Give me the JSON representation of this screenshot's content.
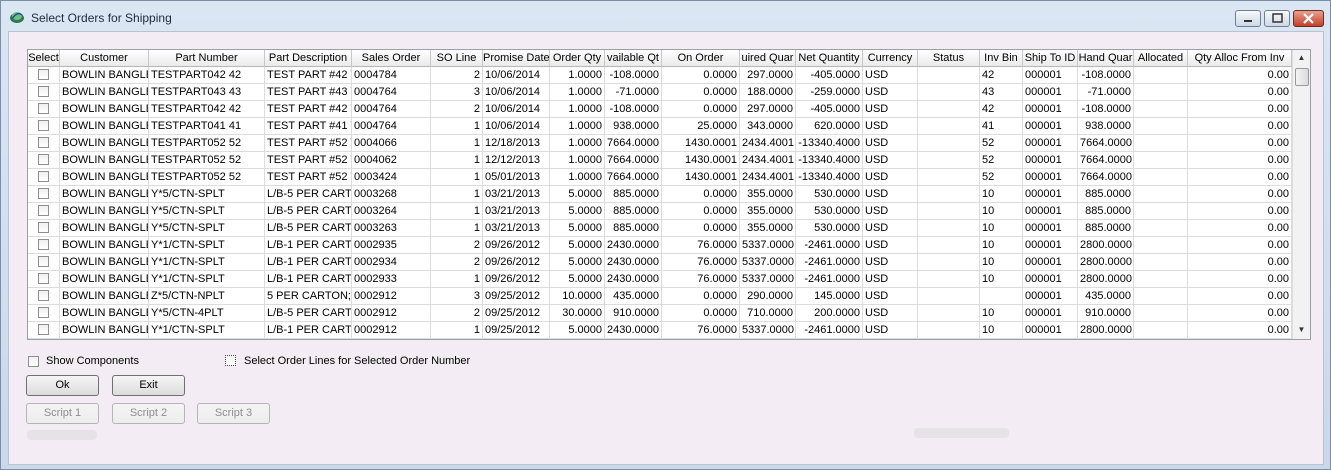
{
  "window": {
    "title": "Select Orders for Shipping"
  },
  "grid": {
    "columns": [
      "Select",
      "Customer",
      "Part Number",
      "Part Description",
      "Sales Order",
      "SO Line",
      "Promise Date",
      "Order Qty",
      "vailable Qt",
      "On Order",
      "uired Quar",
      "Net Quantity",
      "Currency",
      "Status",
      "Inv Bin",
      "Ship To ID",
      "Hand Quar",
      "Allocated",
      "Qty Alloc From Inv"
    ],
    "rows": [
      [
        "BOWLIN BANGLE",
        "TESTPART042      42",
        "TEST PART #42 V",
        "0004784",
        "2",
        "10/06/2014",
        "1.0000",
        "-108.0000",
        "0.0000",
        "297.0000",
        "-405.0000",
        "USD",
        "",
        "42",
        "000001",
        "-108.0000",
        "",
        "0.00"
      ],
      [
        "BOWLIN BANGLE",
        "TESTPART043      43",
        "TEST PART #43 V",
        "0004764",
        "3",
        "10/06/2014",
        "1.0000",
        "-71.0000",
        "0.0000",
        "188.0000",
        "-259.0000",
        "USD",
        "",
        "43",
        "000001",
        "-71.0000",
        "",
        "0.00"
      ],
      [
        "BOWLIN BANGLE",
        "TESTPART042      42",
        "TEST PART #42 V",
        "0004764",
        "2",
        "10/06/2014",
        "1.0000",
        "-108.0000",
        "0.0000",
        "297.0000",
        "-405.0000",
        "USD",
        "",
        "42",
        "000001",
        "-108.0000",
        "",
        "0.00"
      ],
      [
        "BOWLIN BANGLE",
        "TESTPART041      41",
        "TEST PART #41 V",
        "0004764",
        "1",
        "10/06/2014",
        "1.0000",
        "938.0000",
        "25.0000",
        "343.0000",
        "620.0000",
        "USD",
        "",
        "41",
        "000001",
        "938.0000",
        "",
        "0.00"
      ],
      [
        "BOWLIN BANGLE",
        "TESTPART052      52",
        "TEST PART #52 V",
        "0004066",
        "1",
        "12/18/2013",
        "1.0000",
        "7664.0000",
        "1430.0001",
        "2434.4001",
        "-13340.4000",
        "USD",
        "",
        "52",
        "000001",
        "7664.0000",
        "",
        "0.00"
      ],
      [
        "BOWLIN BANGLE",
        "TESTPART052      52",
        "TEST PART #52 V",
        "0004062",
        "1",
        "12/12/2013",
        "1.0000",
        "7664.0000",
        "1430.0001",
        "2434.4001",
        "-13340.4000",
        "USD",
        "",
        "52",
        "000001",
        "7664.0000",
        "",
        "0.00"
      ],
      [
        "BOWLIN BANGLE",
        "TESTPART052      52",
        "TEST PART #52 V",
        "0003424",
        "1",
        "05/01/2013",
        "1.0000",
        "7664.0000",
        "1430.0001",
        "2434.4001",
        "-13340.4000",
        "USD",
        "",
        "52",
        "000001",
        "7664.0000",
        "",
        "0.00"
      ],
      [
        "BOWLIN BANGLE",
        "Y*5/CTN-SPLT",
        "L/B-5 PER CARTC",
        "0003268",
        "1",
        "03/21/2013",
        "5.0000",
        "885.0000",
        "0.0000",
        "355.0000",
        "530.0000",
        "USD",
        "",
        "10",
        "000001",
        "885.0000",
        "",
        "0.00"
      ],
      [
        "BOWLIN BANGLE",
        "Y*5/CTN-SPLT",
        "L/B-5 PER CARTC",
        "0003264",
        "1",
        "03/21/2013",
        "5.0000",
        "885.0000",
        "0.0000",
        "355.0000",
        "530.0000",
        "USD",
        "",
        "10",
        "000001",
        "885.0000",
        "",
        "0.00"
      ],
      [
        "BOWLIN BANGLE",
        "Y*5/CTN-SPLT",
        "L/B-5 PER CARTC",
        "0003263",
        "1",
        "03/21/2013",
        "5.0000",
        "885.0000",
        "0.0000",
        "355.0000",
        "530.0000",
        "USD",
        "",
        "10",
        "000001",
        "885.0000",
        "",
        "0.00"
      ],
      [
        "BOWLIN BANGLE",
        "Y*1/CTN-SPLT",
        "L/B-1 PER CARTC",
        "0002935",
        "2",
        "09/26/2012",
        "5.0000",
        "2430.0000",
        "76.0000",
        "5337.0000",
        "-2461.0000",
        "USD",
        "",
        "10",
        "000001",
        "2800.0000",
        "",
        "0.00"
      ],
      [
        "BOWLIN BANGLE",
        "Y*1/CTN-SPLT",
        "L/B-1 PER CARTC",
        "0002934",
        "2",
        "09/26/2012",
        "5.0000",
        "2430.0000",
        "76.0000",
        "5337.0000",
        "-2461.0000",
        "USD",
        "",
        "10",
        "000001",
        "2800.0000",
        "",
        "0.00"
      ],
      [
        "BOWLIN BANGLE",
        "Y*1/CTN-SPLT",
        "L/B-1 PER CARTC",
        "0002933",
        "1",
        "09/26/2012",
        "5.0000",
        "2430.0000",
        "76.0000",
        "5337.0000",
        "-2461.0000",
        "USD",
        "",
        "10",
        "000001",
        "2800.0000",
        "",
        "0.00"
      ],
      [
        "BOWLIN BANGLE",
        "Z*5/CTN-NPLT",
        "5 PER CARTON; N",
        "0002912",
        "3",
        "09/25/2012",
        "10.0000",
        "435.0000",
        "0.0000",
        "290.0000",
        "145.0000",
        "USD",
        "",
        "",
        "000001",
        "435.0000",
        "",
        "0.00"
      ],
      [
        "BOWLIN BANGLE",
        "Y*5/CTN-4PLT",
        "L/B-5 PER CARTC",
        "0002912",
        "2",
        "09/25/2012",
        "30.0000",
        "910.0000",
        "0.0000",
        "710.0000",
        "200.0000",
        "USD",
        "",
        "10",
        "000001",
        "910.0000",
        "",
        "0.00"
      ],
      [
        "BOWLIN BANGLE",
        "Y*1/CTN-SPLT",
        "L/B-1 PER CARTC",
        "0002912",
        "1",
        "09/25/2012",
        "5.0000",
        "2430.0000",
        "76.0000",
        "5337.0000",
        "-2461.0000",
        "USD",
        "",
        "10",
        "000001",
        "2800.0000",
        "",
        "0.00"
      ]
    ]
  },
  "options": {
    "show_components": "Show Components",
    "select_order_lines": "Select Order Lines for Selected Order Number"
  },
  "buttons": {
    "ok": "Ok",
    "exit": "Exit",
    "script1": "Script 1",
    "script2": "Script 2",
    "script3": "Script 3"
  }
}
